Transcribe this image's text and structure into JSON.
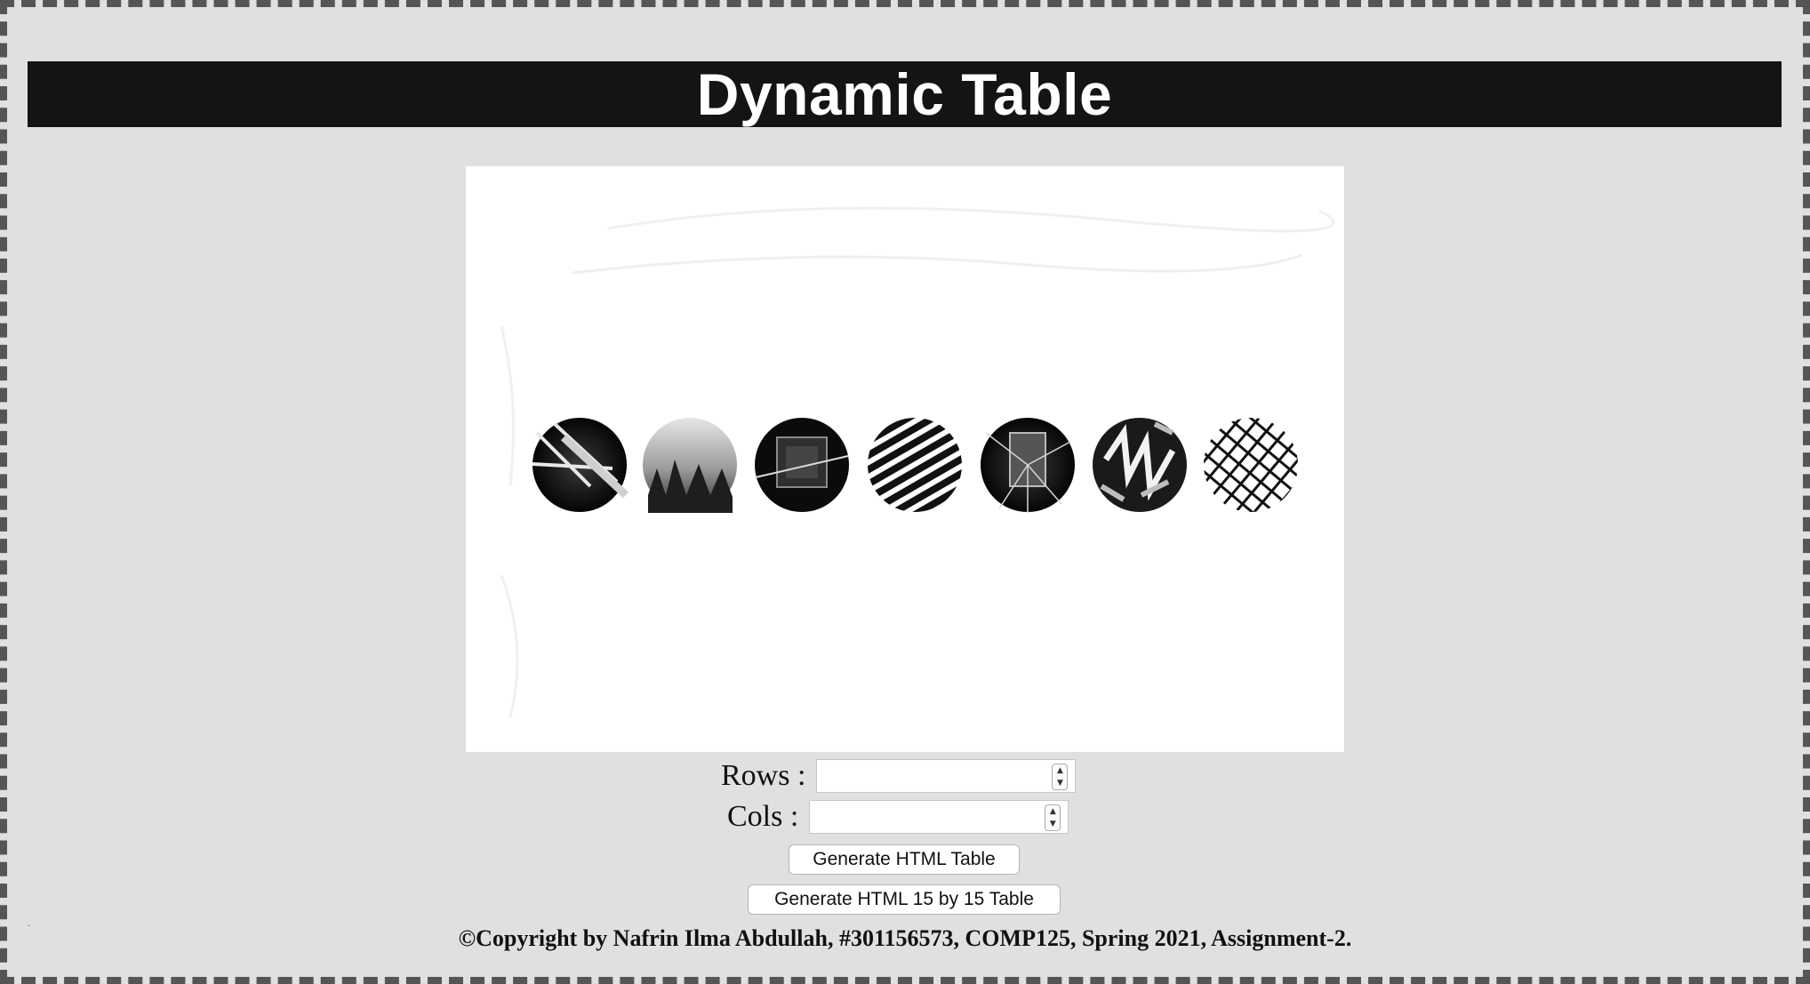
{
  "header": {
    "title": "Dynamic Table"
  },
  "hero": {
    "image_alt": "row of seven monochrome circular texture images",
    "circles": [
      "palm-circle",
      "forest-circle",
      "window-circle",
      "stripes-circle",
      "glass-circle",
      "graffiti-circle",
      "crosshatch-circle"
    ]
  },
  "form": {
    "rows_label": "Rows :",
    "rows_value": "",
    "cols_label": "Cols :",
    "cols_value": "",
    "generate_button": "Generate HTML Table",
    "generate_15_button": "Generate HTML 15 by 15 Table"
  },
  "footer": {
    "copyright": "©Copyright by Nafrin Ilma Abdullah, #301156573, COMP125, Spring 2021, Assignment-2."
  },
  "colors": {
    "background": "#e0e0e0",
    "header_bg": "#141414",
    "border_dash": "#555555"
  }
}
